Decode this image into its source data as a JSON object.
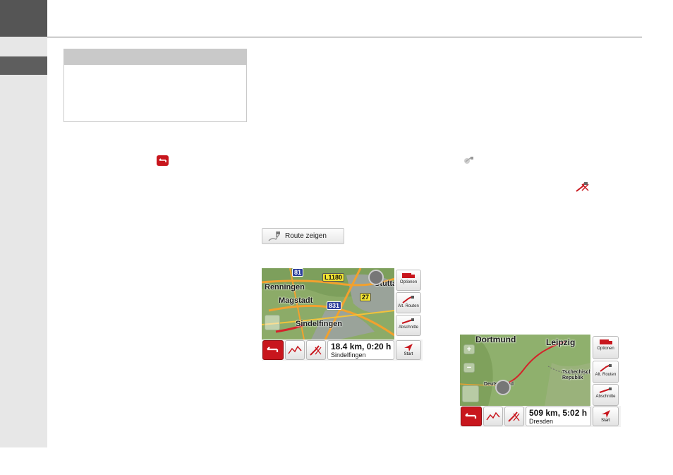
{
  "button": {
    "route_label": "Route zeigen"
  },
  "screen1": {
    "map_labels": {
      "renningen": "Renningen",
      "magstadt": "Magstadt",
      "sindelfingen": "Sindelfingen",
      "stuttgart": "Stutta"
    },
    "road_shields": {
      "r81": "81",
      "l1180": "L1180",
      "r831": "831",
      "r27": "27"
    },
    "side_buttons": {
      "options": "Optionen",
      "alt_routes": "Alt. Routen",
      "sections": "Abschnitte",
      "start": "Start"
    },
    "info": {
      "distance_time": "18.4 km, 0:20 h",
      "destination": "Sindelfingen"
    }
  },
  "screen2": {
    "map_labels": {
      "dortmund": "Dortmund",
      "leipzig": "Leipzig",
      "czech": "Tschechische Republik",
      "deutschland": "Deutschland"
    },
    "zoom": {
      "plus": "+",
      "minus": "−"
    },
    "side_buttons": {
      "options": "Optionen",
      "alt_routes": "Alt. Routen",
      "sections": "Abschnitte",
      "start": "Start"
    },
    "info": {
      "distance_time": "509 km, 5:02 h",
      "destination": "Dresden"
    }
  },
  "colors": {
    "red_button": "#c8161d",
    "route": "#d4232a",
    "map_green": "#7d9f5c"
  }
}
